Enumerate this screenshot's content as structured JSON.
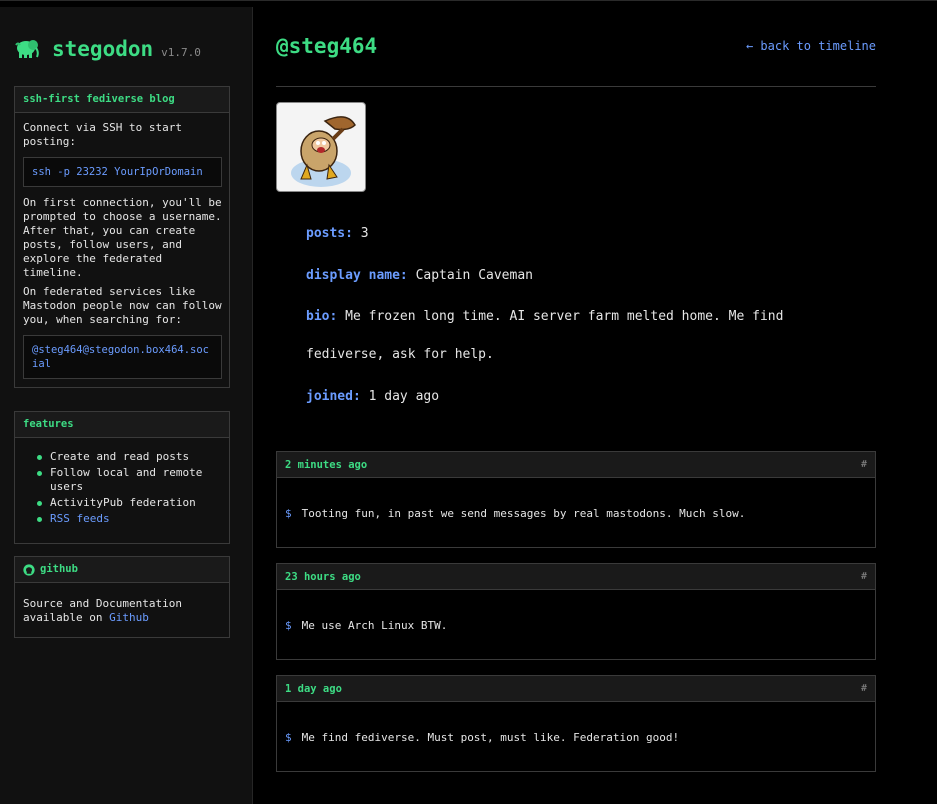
{
  "brand": {
    "name": "stegodon",
    "version": "v1.7.0"
  },
  "sidebar": {
    "ssh_box": {
      "title": "ssh-first fediverse blog",
      "intro": "Connect via SSH to start posting:",
      "command": "ssh -p 23232 YourIpOrDomain",
      "first_connection": "On first connection, you'll be prompted to choose a username. After that, you can create posts, follow users, and explore the federated timeline.",
      "federated": "On federated services like Mastodon people now can follow you, when searching for:",
      "address": "@steg464@stegodon.box464.social"
    },
    "features_box": {
      "title": "features",
      "items": [
        "Create and read posts",
        "Follow local and remote users",
        "ActivityPub federation"
      ],
      "link_item": "RSS feeds"
    },
    "github_box": {
      "title": "github",
      "text": "Source and Documentation available on",
      "link": "Github"
    }
  },
  "profile": {
    "handle": "@steg464",
    "back_link": "← back to timeline",
    "posts_label": "posts:",
    "posts_value": "3",
    "display_name_label": "display name:",
    "display_name_value": "Captain Caveman",
    "bio_label": "bio:",
    "bio_line1": "Me frozen long time. AI server farm melted home. Me find",
    "bio_line2": "fediverse, ask for help.",
    "joined_label": "joined:",
    "joined_value": "1 day ago"
  },
  "posts": [
    {
      "time": "2 minutes ago",
      "hash": "#",
      "prompt": "$",
      "text": "Tooting fun, in past we send messages by real mastodons. Much slow."
    },
    {
      "time": "23 hours ago",
      "hash": "#",
      "prompt": "$",
      "text": "Me use Arch Linux BTW."
    },
    {
      "time": "1 day ago",
      "hash": "#",
      "prompt": "$",
      "text": "Me find fediverse. Must post, must like. Federation good!"
    }
  ],
  "colors": {
    "accent": "#3ddc84",
    "link": "#6b9cff",
    "background": "#000000"
  }
}
